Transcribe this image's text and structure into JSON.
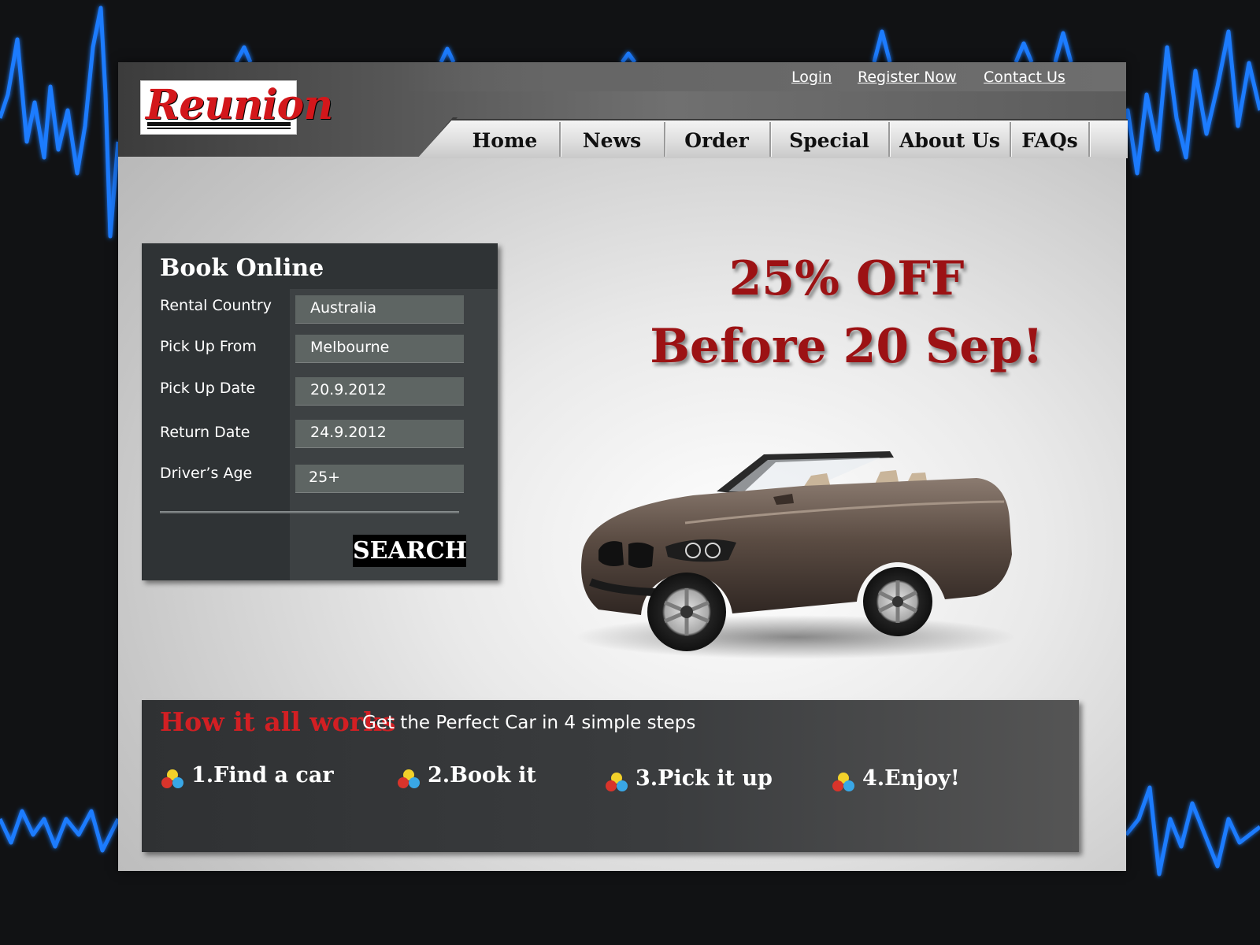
{
  "brand": {
    "logo_text": "Reunion",
    "logo_color": "#d3171b"
  },
  "top_links": [
    {
      "label": "Login"
    },
    {
      "label": "Register Now"
    },
    {
      "label": "Contact Us"
    }
  ],
  "nav": [
    {
      "label": "Home"
    },
    {
      "label": "News"
    },
    {
      "label": "Order"
    },
    {
      "label": "Special"
    },
    {
      "label": "About Us"
    },
    {
      "label": "FAQs"
    }
  ],
  "booking": {
    "title": "Book Online",
    "fields": [
      {
        "label": "Rental Country",
        "value": "Australia"
      },
      {
        "label": "Pick Up From",
        "value": "Melbourne"
      },
      {
        "label": "Pick Up Date",
        "value": "20.9.2012"
      },
      {
        "label": "Return Date",
        "value": "24.9.2012"
      },
      {
        "label": "Driver’s Age",
        "value": "25+"
      }
    ],
    "search_label": "SEARCH"
  },
  "promo": {
    "line1": "25% OFF",
    "line2": "Before 20 Sep!",
    "color": "#9c1214"
  },
  "how": {
    "title": "How it all works",
    "subtitle": "Get the Perfect Car in 4 simple steps",
    "steps": [
      {
        "label": "1.Find a car"
      },
      {
        "label": "2.Book it"
      },
      {
        "label": "3.Pick it up"
      },
      {
        "label": "4.Enjoy!"
      }
    ]
  },
  "colors": {
    "accent_red": "#d21f23",
    "pulse_blue": "#1f7bff"
  }
}
